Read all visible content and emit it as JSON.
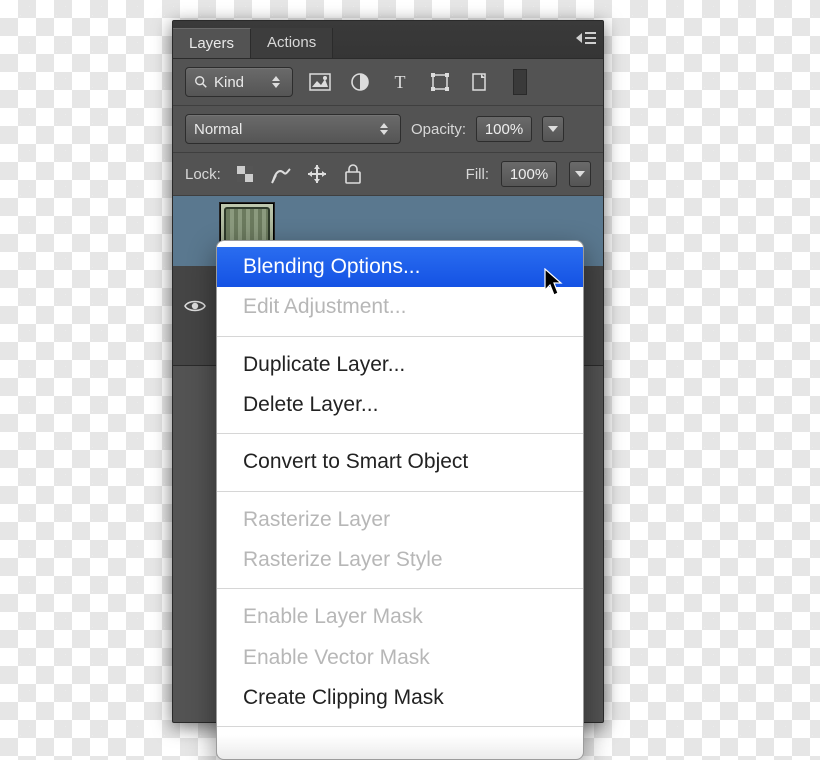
{
  "tabs": {
    "layers": "Layers",
    "actions": "Actions"
  },
  "filter": {
    "kind": "Kind"
  },
  "blend": {
    "mode": "Normal"
  },
  "opacity": {
    "label": "Opacity:",
    "value": "100%"
  },
  "lock": {
    "label": "Lock:"
  },
  "fill": {
    "label": "Fill:",
    "value": "100%"
  },
  "menu": {
    "blending_options": "Blending Options...",
    "edit_adjustment": "Edit Adjustment...",
    "duplicate_layer": "Duplicate Layer...",
    "delete_layer": "Delete Layer...",
    "convert_smart": "Convert to Smart Object",
    "rasterize_layer": "Rasterize Layer",
    "rasterize_layer_style": "Rasterize Layer Style",
    "enable_layer_mask": "Enable Layer Mask",
    "enable_vector_mask": "Enable Vector Mask",
    "create_clipping_mask": "Create Clipping Mask"
  }
}
